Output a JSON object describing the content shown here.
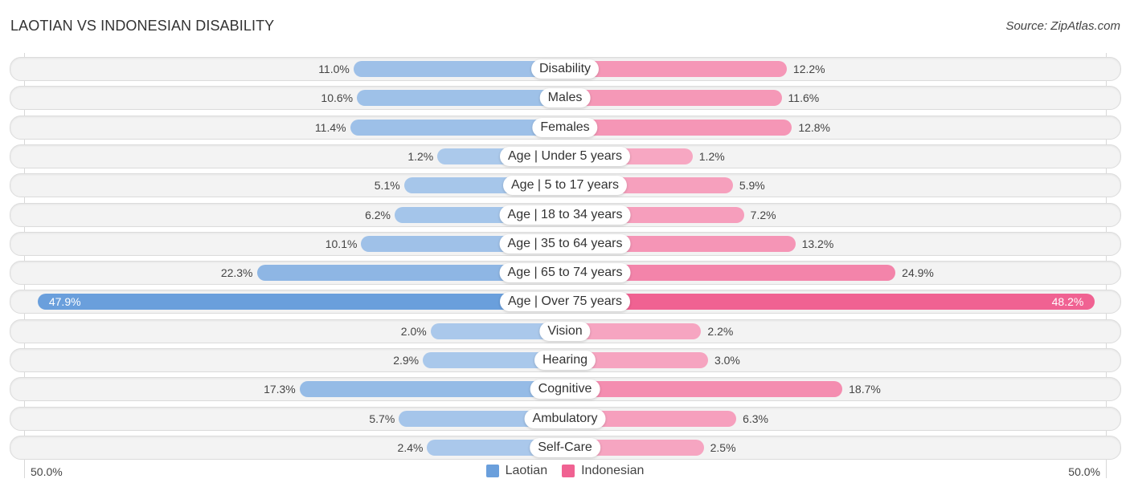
{
  "chart_data": {
    "type": "bar",
    "orientation": "horizontal-diverging",
    "title": "LAOTIAN VS INDONESIAN DISABILITY",
    "source": "Source: ZipAtlas.com",
    "categories": [
      "Disability",
      "Males",
      "Females",
      "Age | Under 5 years",
      "Age | 5 to 17 years",
      "Age | 18 to 34 years",
      "Age | 35 to 64 years",
      "Age | 65 to 74 years",
      "Age | Over 75 years",
      "Vision",
      "Hearing",
      "Cognitive",
      "Ambulatory",
      "Self-Care"
    ],
    "series": [
      {
        "name": "Laotian",
        "color": "#6a9fdc",
        "side": "left",
        "values": [
          11.0,
          10.6,
          11.4,
          1.2,
          5.1,
          6.2,
          10.1,
          22.3,
          47.9,
          2.0,
          2.9,
          17.3,
          5.7,
          2.4
        ],
        "labels": [
          "11.0%",
          "10.6%",
          "11.4%",
          "1.2%",
          "5.1%",
          "6.2%",
          "10.1%",
          "22.3%",
          "47.9%",
          "2.0%",
          "2.9%",
          "17.3%",
          "5.7%",
          "2.4%"
        ]
      },
      {
        "name": "Indonesian",
        "color": "#f06292",
        "side": "right",
        "values": [
          12.2,
          11.6,
          12.8,
          1.2,
          5.9,
          7.2,
          13.2,
          24.9,
          48.2,
          2.2,
          3.0,
          18.7,
          6.3,
          2.5
        ],
        "labels": [
          "12.2%",
          "11.6%",
          "12.8%",
          "1.2%",
          "5.9%",
          "7.2%",
          "13.2%",
          "24.9%",
          "48.2%",
          "2.2%",
          "3.0%",
          "18.7%",
          "6.3%",
          "2.5%"
        ]
      }
    ],
    "xlim": [
      -50,
      50
    ],
    "axis_min_label": "50.0%",
    "axis_max_label": "50.0%",
    "legend_position": "bottom-center",
    "grid": false
  }
}
